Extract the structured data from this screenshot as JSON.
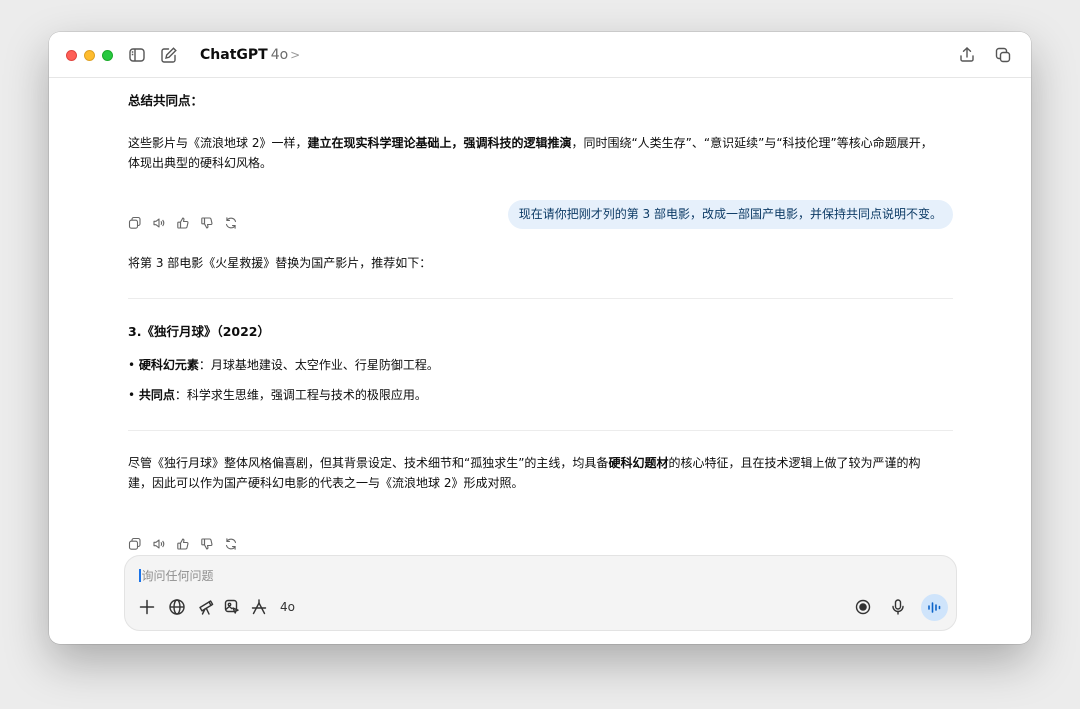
{
  "header": {
    "app_name": "ChatGPT",
    "model_version": "4o",
    "chevron": ">"
  },
  "messages": {
    "summary_heading": "总结共同点：",
    "summary_pre": "这些影片与《流浪地球 2》一样，",
    "summary_bold": "建立在现实科学理论基础上，强调科技的逻辑推演",
    "summary_post": "，同时围绕“人类生存”、“意识延续”与“科技伦理”等核心命题展开，体现出典型的硬科幻风格。",
    "user_bubble": "现在请你把刚才列的第 3 部电影，改成一部国产电影，并保持共同点说明不变。",
    "reply_intro": "将第 3 部电影《火星救援》替换为国产影片，推荐如下：",
    "movie_title": "3.《独行月球》（2022）",
    "bullet1_label": "硬科幻元素",
    "bullet1_text": "：月球基地建设、太空作业、行星防御工程。",
    "bullet2_label": "共同点",
    "bullet2_text": "：科学求生思维，强调工程与技术的极限应用。",
    "closing_pre": "尽管《独行月球》整体风格偏喜剧，但其背景设定、技术细节和“孤独求生”的主线，均具备",
    "closing_bold": "硬科幻题材",
    "closing_post": "的核心特征，且在技术逻辑上做了较为严谨的构建，因此可以作为国产硬科幻电影的代表之一与《流浪地球 2》形成对照。",
    "bullet_dot": "•"
  },
  "composer": {
    "placeholder": "询问任何问题",
    "model_badge": "4o"
  },
  "icons": [
    "sidebar-icon",
    "new-chat-icon",
    "share-icon",
    "new-window-icon",
    "copy-icon",
    "read-aloud-icon",
    "thumbs-up-icon",
    "thumbs-down-icon",
    "regenerate-icon",
    "plus-icon",
    "globe-icon",
    "telescope-icon",
    "image-icon",
    "canvas-icon",
    "record-icon",
    "microphone-icon",
    "voice-mode-icon"
  ],
  "colors": {
    "accent": "#1a73e8",
    "user_bubble_bg": "#e6f0fb",
    "voice_button_bg": "#cfe4fb"
  }
}
